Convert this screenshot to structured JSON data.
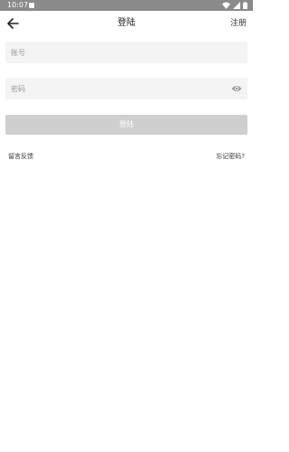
{
  "status_bar": {
    "time": "10:07",
    "icons": [
      "notification-icon",
      "wifi-icon",
      "cellular-signal-icon",
      "battery-icon"
    ]
  },
  "header": {
    "back_icon": "back-arrow-icon",
    "title": "登陆",
    "register_label": "注册"
  },
  "form": {
    "account": {
      "placeholder": "账号",
      "value": ""
    },
    "password": {
      "placeholder": "密码",
      "value": "",
      "toggle_icon": "eye-icon"
    },
    "login_label": "登陆"
  },
  "links": {
    "feedback": "留言反馈",
    "forgot_password": "忘记密码?"
  },
  "colors": {
    "status_bar": "#8a8a8a",
    "field_background": "#f4f4f4",
    "button_disabled": "#cfcfcf"
  }
}
